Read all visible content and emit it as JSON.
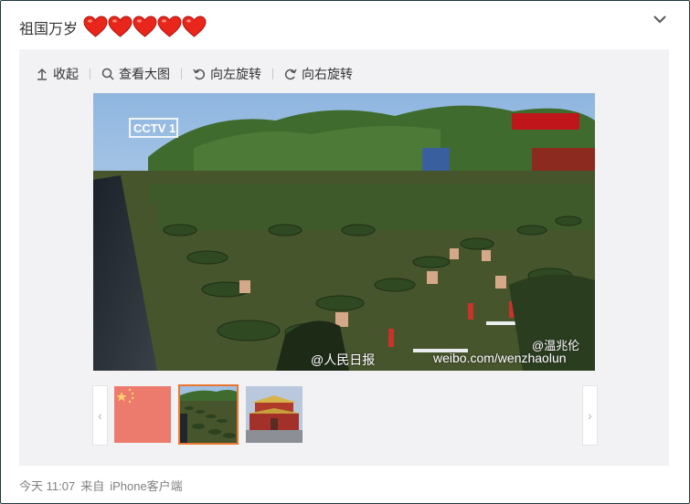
{
  "post": {
    "text": "祖国万岁",
    "hearts_count": 5,
    "heart_icon": "heart-icon",
    "collapse_icon": "chevron-down-icon"
  },
  "toolbar": {
    "collapse_label": "收起",
    "view_large_label": "查看大图",
    "rotate_left_label": "向左旋转",
    "rotate_right_label": "向右旋转"
  },
  "photo": {
    "watermark_source": "@人民日报",
    "watermark_weibo": "weibo.com/wenzhaolun",
    "watermark_user": "@温兆伦",
    "channel_logo": "CCTV 1"
  },
  "thumbnails": {
    "prev_icon": "‹",
    "next_icon": "›",
    "items": [
      {
        "name": "flag-thumbnail",
        "active": false
      },
      {
        "name": "soldiers-thumbnail",
        "active": true
      },
      {
        "name": "tiananmen-thumbnail",
        "active": false
      }
    ]
  },
  "footer": {
    "time": "今天 11:07",
    "source_prefix": "来自",
    "source": "iPhone客户端"
  },
  "colors": {
    "heart": "#e8261c",
    "active_thumb_border": "#e9772f",
    "media_bg": "#f2f2f5"
  }
}
